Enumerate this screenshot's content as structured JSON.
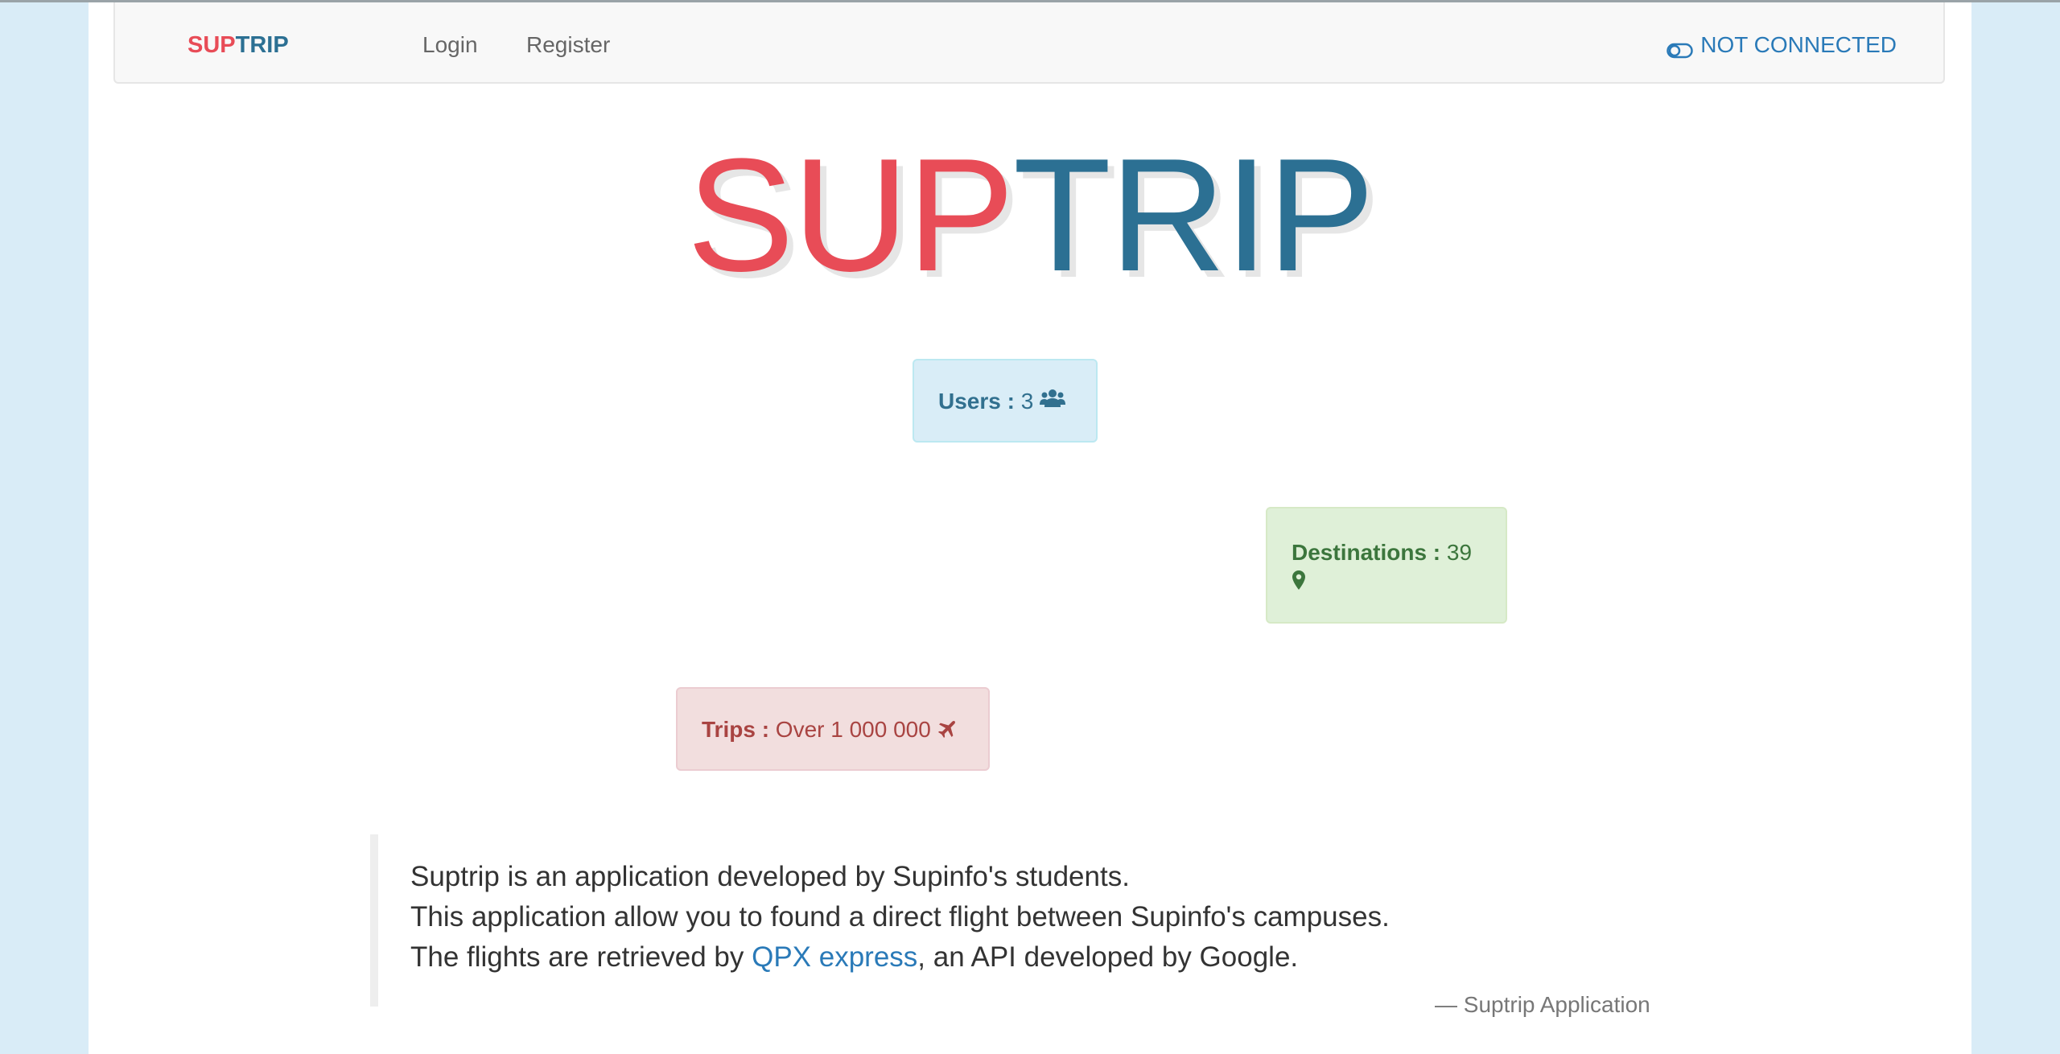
{
  "navbar": {
    "brand_sup": "SUP",
    "brand_trip": "TRIP",
    "login_label": "Login",
    "register_label": "Register",
    "status_label": "NOT CONNECTED",
    "status_icon": "toggle-off-icon"
  },
  "hero": {
    "title_sup": "SUP",
    "title_trip": "TRIP"
  },
  "stats": {
    "users": {
      "label": "Users :",
      "value": "3",
      "icon": "users-icon"
    },
    "destinations": {
      "label": "Destinations :",
      "value": "39",
      "icon": "map-marker-icon"
    },
    "trips": {
      "label": "Trips :",
      "value": "Over 1 000 000",
      "icon": "plane-icon"
    }
  },
  "about": {
    "line1": "Suptrip is an application developed by Supinfo's students.",
    "line2": "This application allow you to found a direct flight between Supinfo's campuses.",
    "line3_prefix": "The flights are retrieved by ",
    "line3_link": "QPX express",
    "line3_suffix": ", an API developed by Google.",
    "cite": "— Suptrip Application"
  },
  "colors": {
    "brand_red": "#e84c57",
    "brand_blue": "#2c7093",
    "link_blue": "#2a7ab8",
    "info_bg": "#d9edf7",
    "success_bg": "#dff0d8",
    "danger_bg": "#f2dede",
    "page_bg": "#d9ecf7"
  }
}
